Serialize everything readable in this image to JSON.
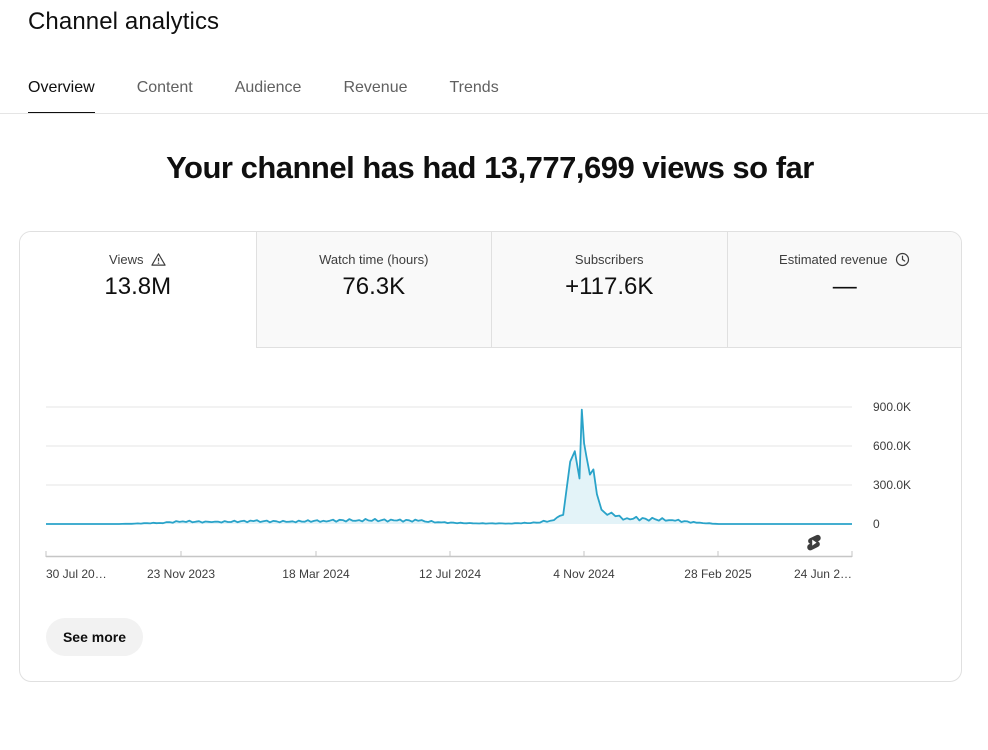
{
  "page": {
    "title": "Channel analytics"
  },
  "tabs": [
    {
      "label": "Overview",
      "active": true
    },
    {
      "label": "Content",
      "active": false
    },
    {
      "label": "Audience",
      "active": false
    },
    {
      "label": "Revenue",
      "active": false
    },
    {
      "label": "Trends",
      "active": false
    }
  ],
  "headline": "Your channel has had 13,777,699 views so far",
  "metrics": [
    {
      "label": "Views",
      "value": "13.8M",
      "icon": "warning-icon"
    },
    {
      "label": "Watch time (hours)",
      "value": "76.3K"
    },
    {
      "label": "Subscribers",
      "value": "+117.6K"
    },
    {
      "label": "Estimated revenue",
      "value": "—",
      "icon": "clock-icon"
    }
  ],
  "see_more_label": "See more",
  "colors": {
    "line": "#2aa3c9",
    "fill": "#e3f3f8",
    "grid": "#e5e5e5",
    "baseline": "#c6c6c6"
  },
  "chart_data": {
    "type": "line",
    "title": "",
    "xlabel": "",
    "ylabel": "",
    "x_tick_labels": [
      "30 Jul 20…",
      "23 Nov 2023",
      "18 Mar 2024",
      "12 Jul 2024",
      "4 Nov 2024",
      "28 Feb 2025",
      "24 Jun 2…"
    ],
    "x_range": [
      "2023-07-30",
      "2025-06-24"
    ],
    "y_tick_labels": [
      "900.0K",
      "600.0K",
      "300.0K",
      "0"
    ],
    "ylim": [
      0,
      900000
    ],
    "y_axis_position": "right",
    "grid": true,
    "series": [
      {
        "x": [
          "2023-07-30",
          "2023-10-01",
          "2023-11-05",
          "2023-11-25",
          "2023-12-20",
          "2024-01-25",
          "2024-02-25",
          "2024-03-25",
          "2024-04-25",
          "2024-05-25",
          "2024-06-15",
          "2024-07-05",
          "2024-08-01",
          "2024-09-01",
          "2024-09-25",
          "2024-10-10",
          "2024-10-18",
          "2024-10-24",
          "2024-10-28",
          "2024-11-01",
          "2024-11-03",
          "2024-11-05",
          "2024-11-07",
          "2024-11-10",
          "2024-11-13",
          "2024-11-16",
          "2024-11-20",
          "2024-11-25",
          "2024-12-02",
          "2024-12-12",
          "2024-12-28",
          "2025-01-20",
          "2025-02-10",
          "2025-03-01",
          "2025-04-15",
          "2025-06-24"
        ],
        "y": [
          0,
          0,
          8000,
          20000,
          15000,
          22000,
          18000,
          25000,
          30000,
          28000,
          25000,
          12000,
          5000,
          4000,
          10000,
          30000,
          70000,
          480000,
          560000,
          350000,
          880000,
          620000,
          520000,
          380000,
          420000,
          230000,
          110000,
          70000,
          60000,
          45000,
          40000,
          30000,
          10000,
          0,
          0,
          0
        ],
        "fill": true
      }
    ],
    "annotations": [
      {
        "type": "icon",
        "name": "shorts-icon",
        "x": "2025-05-22"
      }
    ]
  }
}
